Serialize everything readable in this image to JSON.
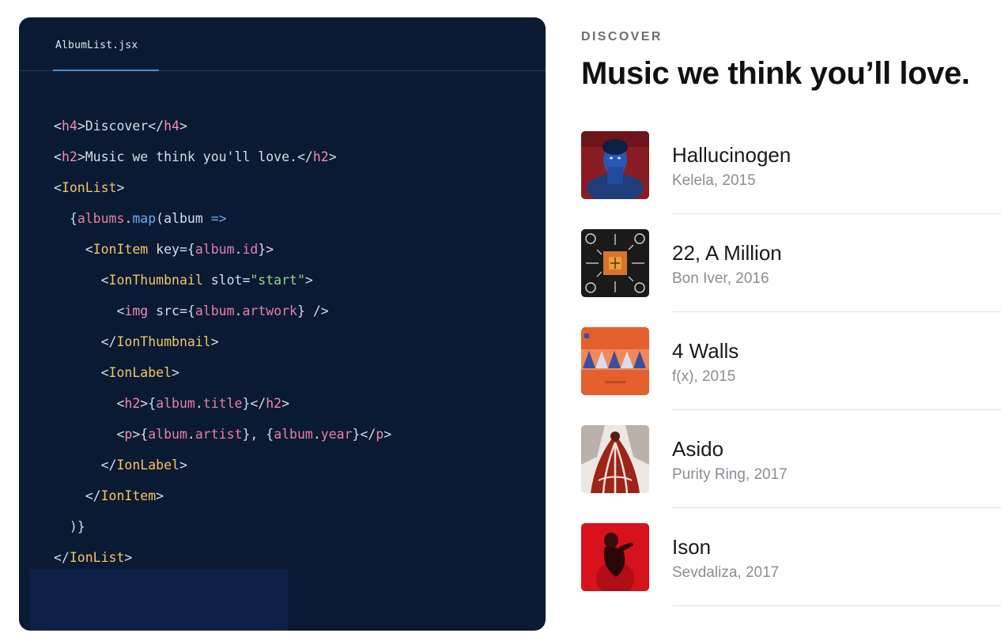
{
  "editor": {
    "filename": "AlbumList.jsx",
    "lines": [
      [
        [
          "t-punc",
          "<"
        ],
        [
          "t-tag",
          "h4"
        ],
        [
          "t-punc",
          ">Discover</"
        ],
        [
          "t-tag",
          "h4"
        ],
        [
          "t-punc",
          ">"
        ]
      ],
      [
        [
          "t-punc",
          "<"
        ],
        [
          "t-tag",
          "h2"
        ],
        [
          "t-punc",
          ">Music we think you'll love.</"
        ],
        [
          "t-tag",
          "h2"
        ],
        [
          "t-punc",
          ">"
        ]
      ],
      [
        [
          "t-punc",
          "<"
        ],
        [
          "t-comp",
          "IonList"
        ],
        [
          "t-punc",
          ">"
        ]
      ],
      [
        [
          "t-punc",
          "  {"
        ],
        [
          "t-var",
          "albums"
        ],
        [
          "t-punc",
          "."
        ],
        [
          "t-fn",
          "map"
        ],
        [
          "t-punc",
          "(album "
        ],
        [
          "t-op",
          "=>"
        ]
      ],
      [
        [
          "t-punc",
          "    <"
        ],
        [
          "t-comp",
          "IonItem"
        ],
        [
          "t-attr",
          " key"
        ],
        [
          "t-punc",
          "={"
        ],
        [
          "t-var",
          "album"
        ],
        [
          "t-punc",
          "."
        ],
        [
          "t-var",
          "id"
        ],
        [
          "t-punc",
          "}>"
        ]
      ],
      [
        [
          "t-punc",
          "      <"
        ],
        [
          "t-comp",
          "IonThumbnail"
        ],
        [
          "t-attr",
          " slot"
        ],
        [
          "t-punc",
          "="
        ],
        [
          "t-str",
          "\"start\""
        ],
        [
          "t-punc",
          ">"
        ]
      ],
      [
        [
          "t-punc",
          "        <"
        ],
        [
          "t-tag",
          "img"
        ],
        [
          "t-attr",
          " src"
        ],
        [
          "t-punc",
          "={"
        ],
        [
          "t-var",
          "album"
        ],
        [
          "t-punc",
          "."
        ],
        [
          "t-var",
          "artwork"
        ],
        [
          "t-punc",
          "} />"
        ]
      ],
      [
        [
          "t-punc",
          "      </"
        ],
        [
          "t-comp",
          "IonThumbnail"
        ],
        [
          "t-punc",
          ">"
        ]
      ],
      [
        [
          "t-punc",
          "      <"
        ],
        [
          "t-comp",
          "IonLabel"
        ],
        [
          "t-punc",
          ">"
        ]
      ],
      [
        [
          "t-punc",
          "        <"
        ],
        [
          "t-tag",
          "h2"
        ],
        [
          "t-punc",
          ">{"
        ],
        [
          "t-var",
          "album"
        ],
        [
          "t-punc",
          "."
        ],
        [
          "t-var",
          "title"
        ],
        [
          "t-punc",
          "}</"
        ],
        [
          "t-tag",
          "h2"
        ],
        [
          "t-punc",
          ">"
        ]
      ],
      [
        [
          "t-punc",
          "        <"
        ],
        [
          "t-tag",
          "p"
        ],
        [
          "t-punc",
          ">{"
        ],
        [
          "t-var",
          "album"
        ],
        [
          "t-punc",
          "."
        ],
        [
          "t-var",
          "artist"
        ],
        [
          "t-punc",
          "}, {"
        ],
        [
          "t-var",
          "album"
        ],
        [
          "t-punc",
          "."
        ],
        [
          "t-var",
          "year"
        ],
        [
          "t-punc",
          "}</"
        ],
        [
          "t-tag",
          "p"
        ],
        [
          "t-punc",
          ">"
        ]
      ],
      [
        [
          "t-punc",
          "      </"
        ],
        [
          "t-comp",
          "IonLabel"
        ],
        [
          "t-punc",
          ">"
        ]
      ],
      [
        [
          "t-punc",
          "    </"
        ],
        [
          "t-comp",
          "IonItem"
        ],
        [
          "t-punc",
          ">"
        ]
      ],
      [
        [
          "t-punc",
          "  )}"
        ]
      ],
      [
        [
          "t-punc",
          "</"
        ],
        [
          "t-comp",
          "IonList"
        ],
        [
          "t-punc",
          ">"
        ]
      ]
    ]
  },
  "preview": {
    "eyebrow": "DISCOVER",
    "headline": "Music we think you’ll love.",
    "albums": [
      {
        "title": "Hallucinogen",
        "meta": "Kelela, 2015",
        "artwork_icon": "album-art-hallucinogen"
      },
      {
        "title": "22, A Million",
        "meta": "Bon Iver, 2016",
        "artwork_icon": "album-art-22-a-million"
      },
      {
        "title": "4 Walls",
        "meta": "f(x), 2015",
        "artwork_icon": "album-art-4-walls"
      },
      {
        "title": "Asido",
        "meta": "Purity Ring, 2017",
        "artwork_icon": "album-art-asido"
      },
      {
        "title": "Ison",
        "meta": "Sevdaliza, 2017",
        "artwork_icon": "album-art-ison"
      }
    ]
  }
}
